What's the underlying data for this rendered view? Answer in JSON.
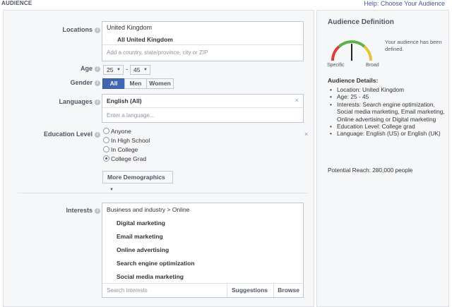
{
  "header": {
    "title": "AUDIENCE",
    "help_link": "Help: Choose Your Audience"
  },
  "form": {
    "locations": {
      "label": "Locations",
      "country": "United Kingdom",
      "scope": "All United Kingdom",
      "placeholder": "Add a country, state/province, city or ZIP"
    },
    "age": {
      "label": "Age",
      "min": "25",
      "max": "45",
      "separator": "-"
    },
    "gender": {
      "label": "Gender",
      "options": [
        "All",
        "Men",
        "Women"
      ],
      "selected": "All"
    },
    "languages": {
      "label": "Languages",
      "selected": "English (All)",
      "placeholder": "Enter a language..."
    },
    "education": {
      "label": "Education Level",
      "options": [
        "Anyone",
        "In High School",
        "In College",
        "College Grad"
      ],
      "selected": "College Grad"
    },
    "more_demographics": "More Demographics",
    "interests": {
      "label": "Interests",
      "path": "Business and industry > Online",
      "items": [
        "Digital marketing",
        "Email marketing",
        "Online advertising",
        "Search engine optimization",
        "Social media marketing"
      ],
      "search_placeholder": "Search interests",
      "suggestions_label": "Suggestions",
      "browse_label": "Browse"
    }
  },
  "sidebar": {
    "title": "Audience Definition",
    "gauge": {
      "left_label": "Specific",
      "right_label": "Broad",
      "needle_position": 0.5
    },
    "status_text": "Your audience has been defined.",
    "details_title": "Audience Details:",
    "details": [
      "Location: United Kingdom",
      "Age: 25 - 45",
      "Interests: Search engine optimization, Social media marketing, Email marketing, Online advertising or Digital marketing",
      "Education Level: College grad",
      "Language: English (US) or English (UK)"
    ],
    "potential_reach": "Potential Reach: 280,000 people"
  },
  "colors": {
    "accent": "#4267b2",
    "link": "#3b5998",
    "panel_bg": "#f6f7f9",
    "gauge_red": "#d8413a",
    "gauge_yellow": "#e8c23b",
    "gauge_green": "#5fb14c"
  },
  "icons": {
    "info": "info-icon",
    "remove": "close-icon",
    "dropdown": "chevron-down-icon"
  }
}
